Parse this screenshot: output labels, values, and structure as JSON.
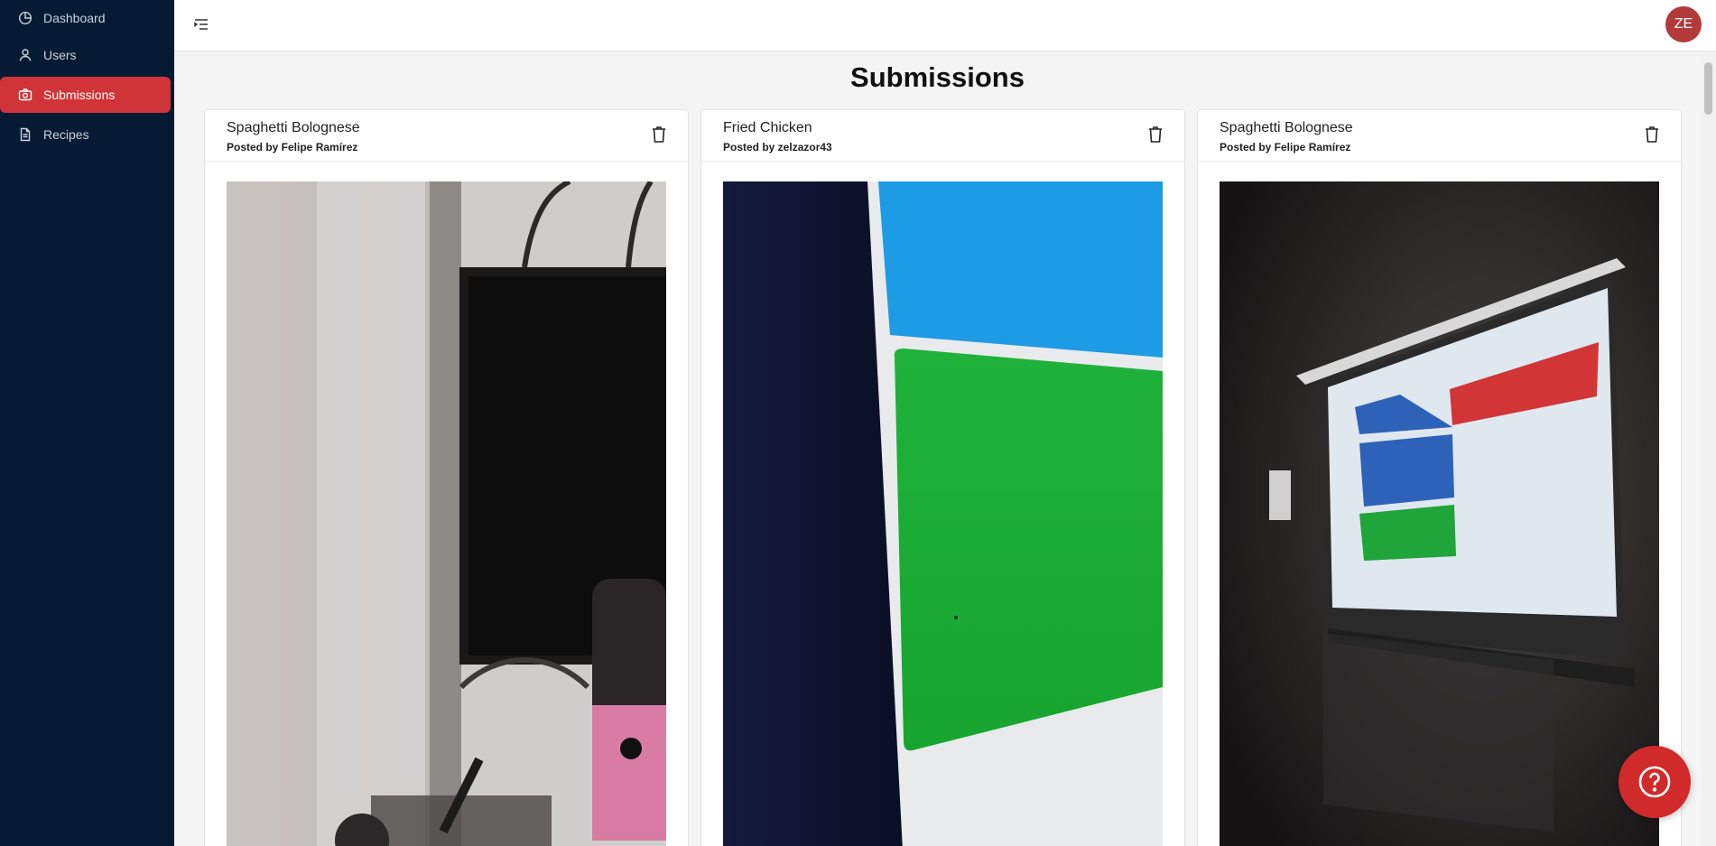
{
  "sidebar": {
    "items": [
      {
        "label": "Dashboard",
        "icon": "dashboard-icon",
        "active": false
      },
      {
        "label": "Users",
        "icon": "user-icon",
        "active": false
      },
      {
        "label": "Submissions",
        "icon": "camera-icon",
        "active": true
      },
      {
        "label": "Recipes",
        "icon": "document-icon",
        "active": false
      }
    ]
  },
  "header": {
    "menu_icon": "menu-collapse-icon",
    "avatar_initials": "ZE"
  },
  "main": {
    "title": "Submissions",
    "cards": [
      {
        "title": "Spaghetti Bolognese",
        "posted_by": "Posted by Felipe Ramírez",
        "delete_icon": "trash-icon",
        "photo": "desk-monitor-microphone-photo"
      },
      {
        "title": "Fried Chicken",
        "posted_by": "Posted by zelzazor43",
        "delete_icon": "trash-icon",
        "photo": "screen-blue-green-tiles-photo"
      },
      {
        "title": "Spaghetti Bolognese",
        "posted_by": "Posted by Felipe Ramírez",
        "delete_icon": "trash-icon",
        "photo": "projector-dashboard-photo"
      }
    ]
  },
  "help": {
    "icon": "help-circle-icon"
  },
  "colors": {
    "sidebar": "#061b33",
    "accent": "#d13438",
    "avatar": "#b23a3a"
  }
}
